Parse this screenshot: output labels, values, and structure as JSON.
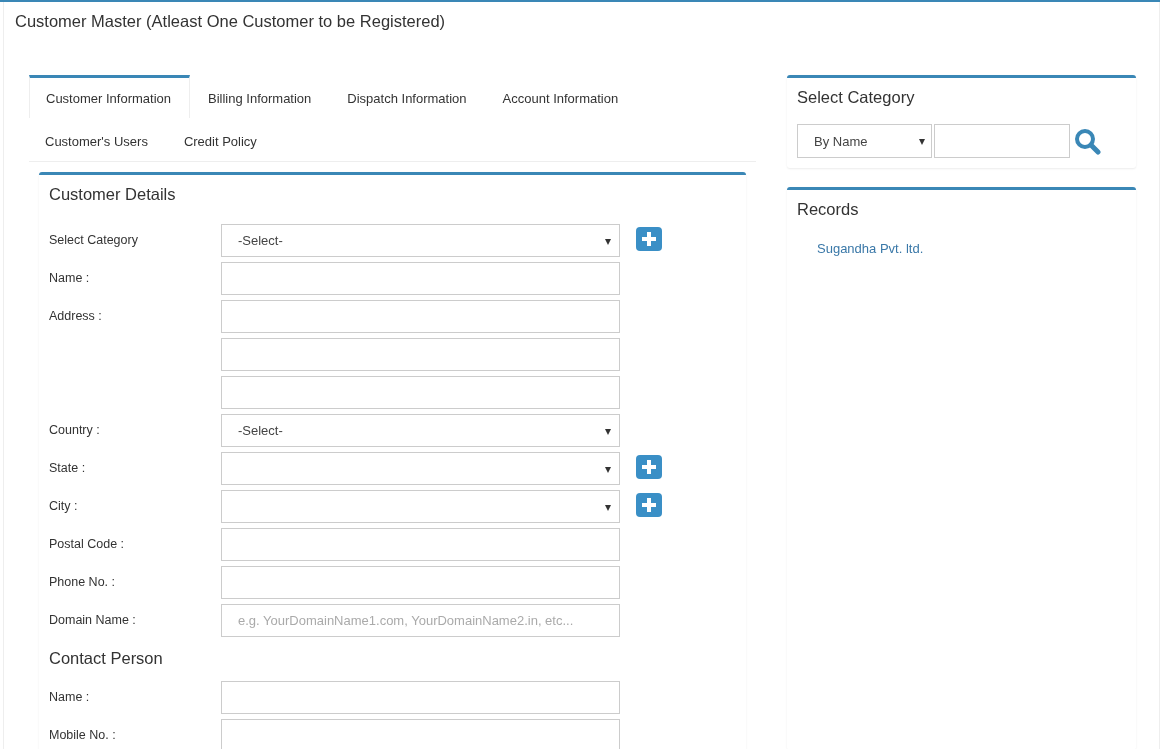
{
  "page": {
    "title": "Customer Master (Atleast One Customer to be Registered)"
  },
  "tabs": [
    {
      "label": "Customer Information",
      "selected": true
    },
    {
      "label": "Billing Information",
      "selected": false
    },
    {
      "label": "Dispatch Information",
      "selected": false
    },
    {
      "label": "Account Information",
      "selected": false
    },
    {
      "label": "Customer's Users",
      "selected": false
    },
    {
      "label": "Credit Policy",
      "selected": false
    }
  ],
  "customer_details": {
    "heading": "Customer Details",
    "fields": [
      {
        "label": "Select Category",
        "kind": "select",
        "value": "-Select-",
        "add_button": true
      },
      {
        "label": "Name :",
        "kind": "text"
      },
      {
        "label": "Address :",
        "kind": "text"
      },
      {
        "kind": "text"
      },
      {
        "kind": "text"
      },
      {
        "label": "Country :",
        "kind": "select",
        "value": "-Select-"
      },
      {
        "label": "State :",
        "kind": "select",
        "add_button": true
      },
      {
        "label": "City :",
        "kind": "select",
        "add_button": true
      },
      {
        "label": "Postal Code :",
        "kind": "text"
      },
      {
        "label": "Phone No. :",
        "kind": "text"
      },
      {
        "label": "Domain Name :",
        "kind": "text",
        "placeholder": "e.g. YourDomainName1.com, YourDomainName2.in, etc..."
      }
    ]
  },
  "contact_person": {
    "heading": "Contact Person",
    "fields": [
      {
        "label": "Name :",
        "kind": "text"
      },
      {
        "label": "Mobile No. :",
        "kind": "text"
      }
    ]
  },
  "select_category": {
    "heading": "Select Category",
    "filter": {
      "value": "By Name"
    }
  },
  "records": {
    "heading": "Records",
    "items": [
      "Sugandha Pvt. ltd."
    ]
  }
}
